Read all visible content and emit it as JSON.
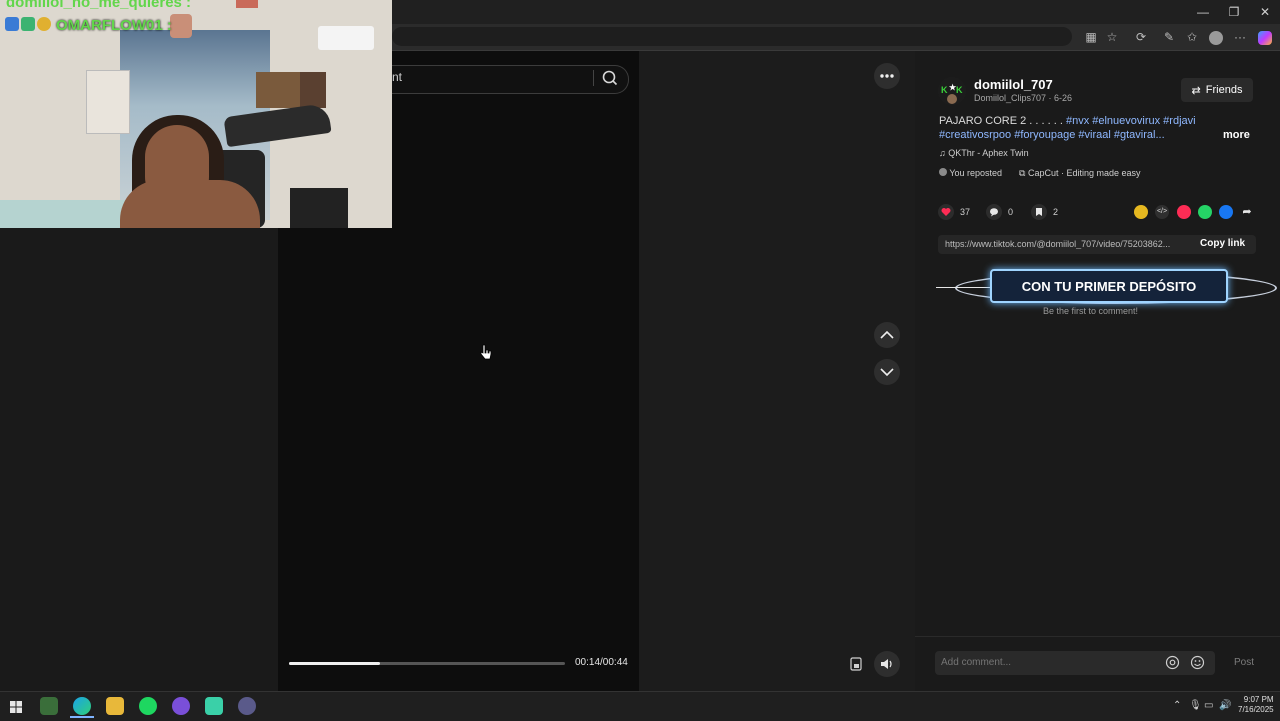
{
  "search": {
    "placeholder_fragment": "nt"
  },
  "webcam": {
    "chat_line_top": "domiilol_no_me_quieres :",
    "chat_line_user": "OMARFLOW01 :"
  },
  "video": {
    "time": "00:14/00:44",
    "progress_fraction": 0.33
  },
  "post": {
    "username": "domiilol_707",
    "handle_date": "Domiilol_Clips707 · 6-26",
    "friends_label": "Friends",
    "desc_prefix": "PAJARO CORE 2 . . . . . .",
    "tags_line1": "#nvx #elnuevovirux #rdjavi",
    "tags_line2": "#creativosrpoo #foryoupage #viraal #gtaviral...",
    "more_label": "more",
    "music": "QKThr - Aphex Twin",
    "reposted": "You reposted",
    "capcut": "CapCut · Editing made easy",
    "likes": "37",
    "comments": "0",
    "saves": "2",
    "link": "https://www.tiktok.com/@domiilol_707/video/75203862...",
    "copy_link_label": "Copy link",
    "banner_text": "CON TU PRIMER DEPÓSITO",
    "first_comment": "Be the first to comment!",
    "comment_placeholder": "Add comment...",
    "post_label": "Post"
  },
  "taskbar": {
    "time": "9:07 PM",
    "date": "7/16/2025"
  },
  "colors": {
    "accent_like": "#fe2c55",
    "tag_blue": "#8fb8ff",
    "chat_green": "#62d64b"
  },
  "icons": [
    "search-icon",
    "more-icon",
    "chevron-up-icon",
    "chevron-down-icon",
    "volume-icon",
    "minimize-icon",
    "maximize-icon",
    "close-icon",
    "heart-icon",
    "comment-icon",
    "bookmark-icon",
    "music-note-icon",
    "repost-icon",
    "capcut-icon",
    "share-arrow-icon",
    "mention-icon",
    "emoji-icon"
  ]
}
